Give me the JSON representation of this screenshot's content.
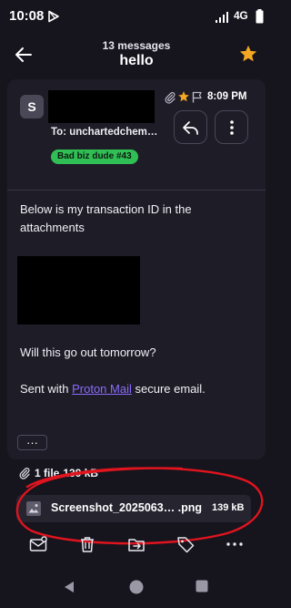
{
  "status_bar": {
    "time": "10:08",
    "network": "4G"
  },
  "header": {
    "message_count": "13 messages",
    "subject": "hello"
  },
  "email": {
    "avatar_letter": "S",
    "to": "To: unchartedchem…",
    "label": "Bad biz dude #43",
    "time": "8:09 PM",
    "body_line1": "Below is my transaction ID in the attachments",
    "body_line2": "Will this go out tomorrow?",
    "signature_prefix": "Sent with",
    "signature_link": "Proton Mail",
    "signature_suffix": "secure email.",
    "expand_label": "···"
  },
  "attachments": {
    "summary_count": "1 file",
    "summary_size": "139 kB",
    "items": [
      {
        "name": "Screenshot_2025063… .png",
        "size": "139 kB"
      }
    ]
  },
  "colors": {
    "background": "#16141d",
    "card": "#1e1c27",
    "accent_star": "#f5a623",
    "label_chip": "#2fbf55",
    "link": "#8a6dff",
    "annotation": "#e0141e"
  },
  "icons": [
    "play-store-icon",
    "signal-icon",
    "battery-icon",
    "back-arrow-icon",
    "star-icon",
    "paperclip-icon",
    "flag-icon",
    "reply-icon",
    "more-vertical-icon",
    "image-file-icon",
    "mark-unread-icon",
    "trash-icon",
    "move-to-folder-icon",
    "label-icon",
    "more-horizontal-icon",
    "nav-back-icon",
    "nav-home-icon",
    "nav-recents-icon"
  ]
}
